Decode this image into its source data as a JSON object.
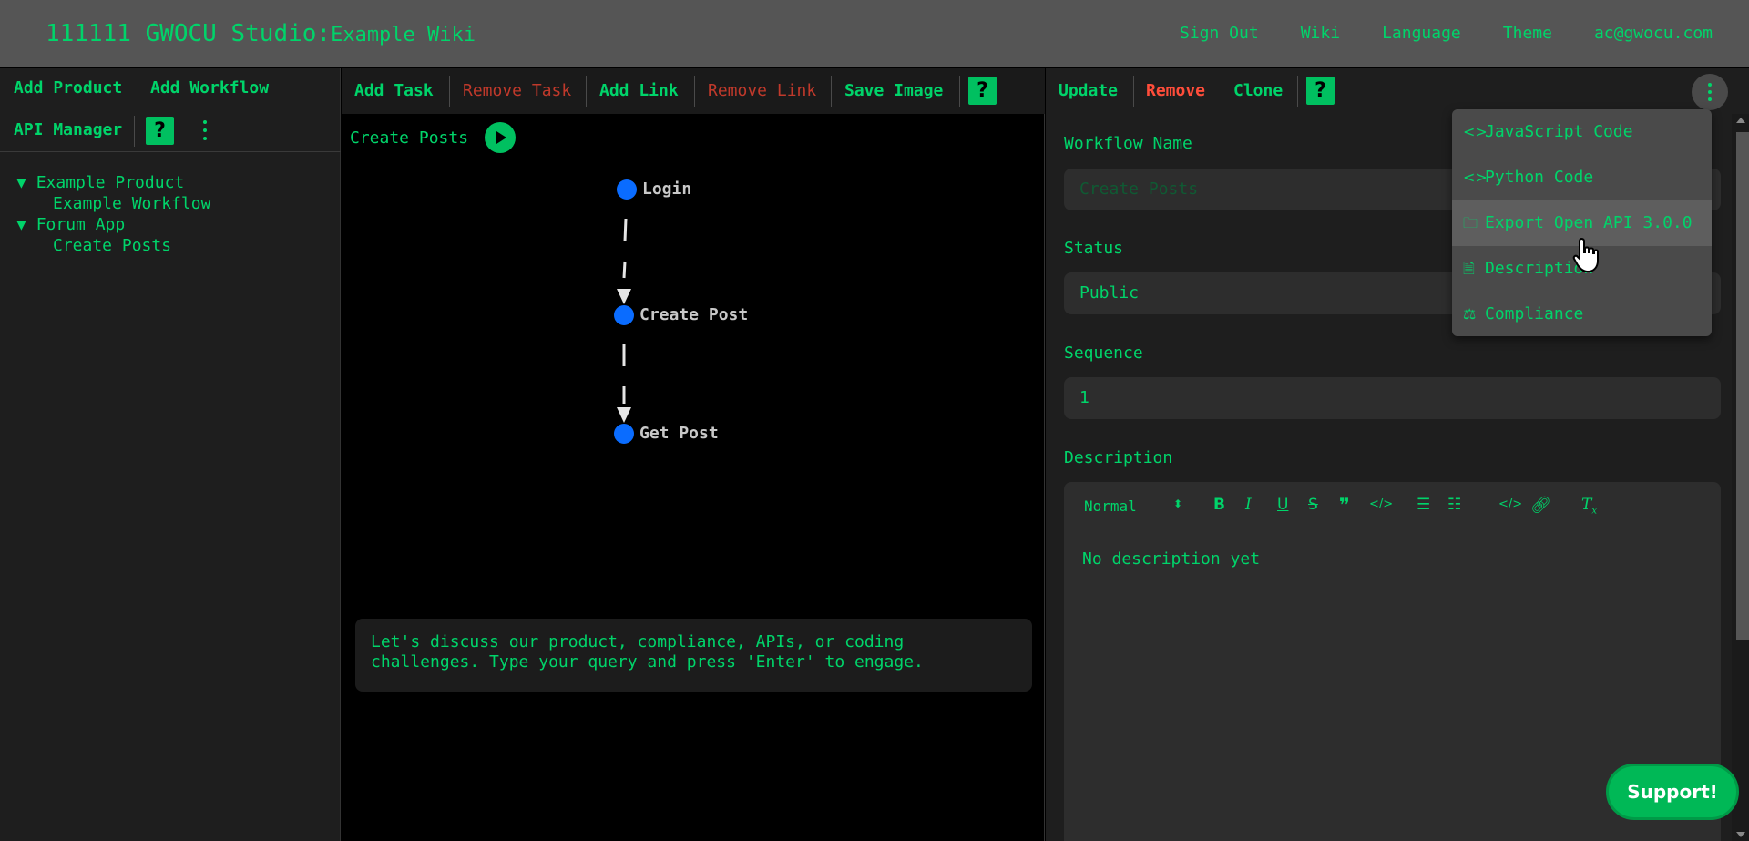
{
  "header": {
    "brand": "111111 GWOCU Studio:",
    "wiki_name": "Example Wiki",
    "nav": [
      "Sign Out",
      "Wiki",
      "Language",
      "Theme",
      "ac@gwocu.com"
    ]
  },
  "left_toolbar": {
    "add_product": "Add Product",
    "add_workflow": "Add Workflow",
    "api_manager": "API Manager",
    "help": "?"
  },
  "tree": {
    "products": [
      {
        "arrow": "▼",
        "name": "Example Product",
        "workflows": [
          "Example Workflow"
        ]
      },
      {
        "arrow": "▼",
        "name": "Forum App",
        "workflows": [
          "Create Posts"
        ]
      }
    ]
  },
  "center_toolbar": {
    "add_task": "Add Task",
    "remove_task": "Remove Task",
    "add_link": "Add Link",
    "remove_link": "Remove Link",
    "save_image": "Save Image",
    "help": "?"
  },
  "workflow": {
    "title": "Create Posts",
    "nodes": [
      "Login",
      "Create Post",
      "Get Post"
    ]
  },
  "chat": {
    "placeholder": "Let's discuss our product, compliance, APIs, or coding challenges. Type your query and press 'Enter' to engage."
  },
  "right_toolbar": {
    "update": "Update",
    "remove": "Remove",
    "clone": "Clone",
    "help": "?"
  },
  "form": {
    "name_label": "Workflow Name",
    "name_value": "Create Posts",
    "status_label": "Status",
    "status_value": "Public",
    "sequence_label": "Sequence",
    "sequence_value": "1",
    "description_label": "Description",
    "editor_format": "Normal",
    "description_value": "No description yet"
  },
  "menu": {
    "items": [
      {
        "icon": "code-icon",
        "glyph": "<>",
        "label": "JavaScript Code"
      },
      {
        "icon": "code-icon",
        "glyph": "<>",
        "label": "Python Code"
      },
      {
        "icon": "folder-icon",
        "glyph": "🗀",
        "label": "Export Open API 3.0.0"
      },
      {
        "icon": "document-icon",
        "glyph": "🗎",
        "label": "Description"
      },
      {
        "icon": "scale-icon",
        "glyph": "⚖",
        "label": "Compliance"
      }
    ]
  },
  "support_button": "Support!",
  "colors": {
    "accent": "#00d46a",
    "danger": "#c0392b",
    "header_bg": "#555555",
    "panel_bg": "#1e1e1e",
    "node": "#0a6cff"
  }
}
